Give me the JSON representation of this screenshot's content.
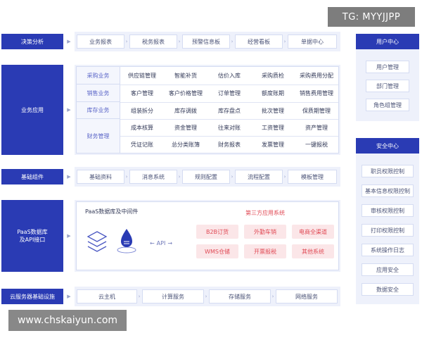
{
  "watermark_top": "TG: MYYJJPP",
  "watermark_bottom": "www.chskaiyun.com",
  "rows": {
    "decision": {
      "label": "决策分析",
      "items": [
        "业务报表",
        "税务报表",
        "预警信息板",
        "经营看板",
        "单据中心"
      ]
    },
    "business": {
      "label": "业务应用",
      "groups": [
        {
          "label": "采购业务",
          "items": [
            "供应链管理",
            "智能补货",
            "估价入库",
            "采购质检",
            "采购费用分配"
          ]
        },
        {
          "label": "销售业务",
          "items": [
            "客户管理",
            "客户价格管理",
            "订单管理",
            "额度账期",
            "销售费用管理"
          ]
        },
        {
          "label": "库存业务",
          "items": [
            "组装拆分",
            "库存调拨",
            "库存盘点",
            "批次管理",
            "保质期管理"
          ]
        },
        {
          "label": "财务管理",
          "items": [
            "成本核算",
            "资金管理",
            "往来对账",
            "工资管理",
            "资产管理",
            "凭证记账",
            "总分类账簿",
            "财务报表",
            "发票管理",
            "一键报税"
          ]
        }
      ]
    },
    "base": {
      "label": "基础组件",
      "items": [
        "基础资料",
        "消息系统",
        "规则配置",
        "流程配置",
        "模板管理"
      ]
    },
    "paas": {
      "label_line1": "PaaS数据库",
      "label_line2": "及API接口",
      "inner_title": "PaaS数据库及中间件",
      "api_label": "API",
      "third_party_title": "第三方应用系统",
      "third_party_items": [
        "B2B订货",
        "外勤车销",
        "电商全渠道",
        "WMS仓储",
        "开票报税",
        "其他系统"
      ]
    },
    "cloud": {
      "label": "云服务器基础设施",
      "items": [
        "云主机",
        "计算服务",
        "存储服务",
        "网络服务"
      ]
    }
  },
  "user_center": {
    "title": "用户中心",
    "items": [
      "用户管理",
      "部门管理",
      "角色组管理"
    ]
  },
  "security_center": {
    "title": "安全中心",
    "items": [
      "职员权限控制",
      "基本信息权限控制",
      "审核权限控制",
      "打印权限控制",
      "系统操作日志",
      "应用安全",
      "数据安全"
    ]
  },
  "colors": {
    "primary_blue": "#2a3bb4",
    "panel_bg": "#eef1fb",
    "accent_red": "#e04a55"
  }
}
